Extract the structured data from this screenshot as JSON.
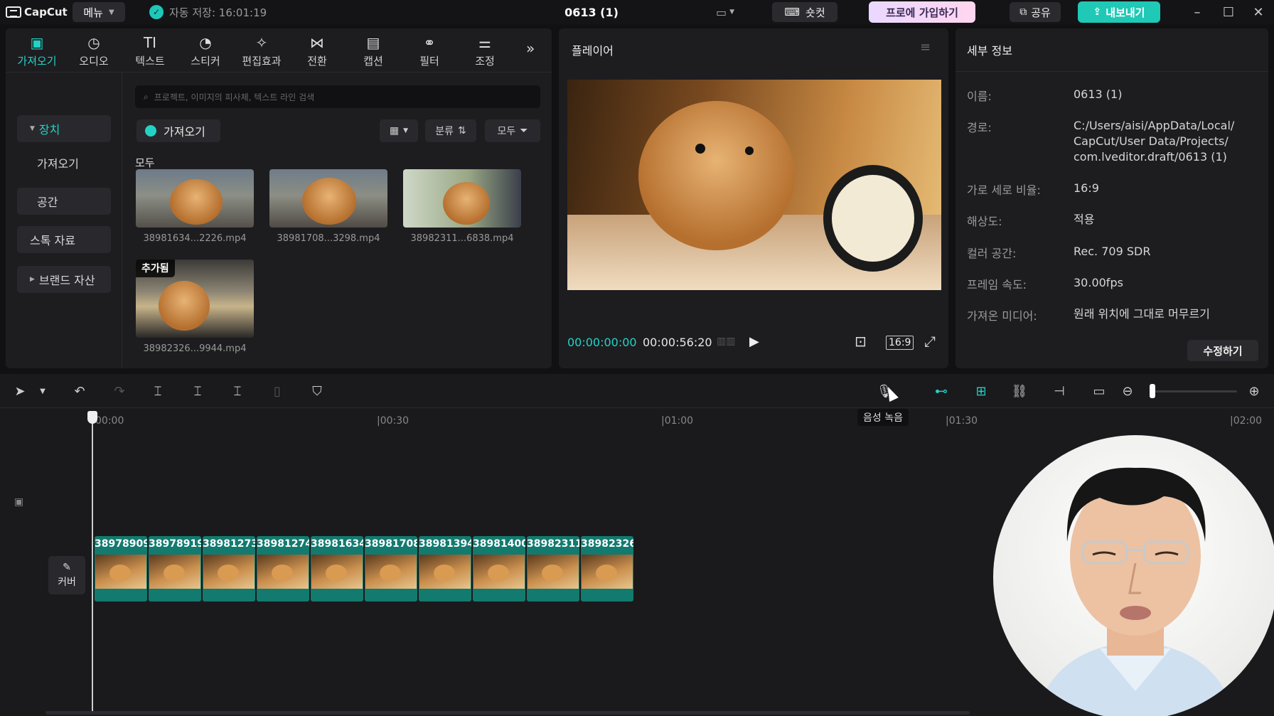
{
  "titlebar": {
    "app_name": "CapCut",
    "menu_label": "메뉴",
    "autosave": "자동 저장: 16:01:19",
    "project_title": "0613 (1)",
    "shortcut_label": "숏컷",
    "pro_label": "프로에 가입하기",
    "share_label": "공유",
    "export_label": "내보내기"
  },
  "media": {
    "tools": [
      {
        "label": "가져오기",
        "icon": "▣"
      },
      {
        "label": "오디오",
        "icon": "◷"
      },
      {
        "label": "텍스트",
        "icon": "TI"
      },
      {
        "label": "스티커",
        "icon": "◔"
      },
      {
        "label": "편집효과",
        "icon": "✧"
      },
      {
        "label": "전환",
        "icon": "⋈"
      },
      {
        "label": "캡션",
        "icon": "▤"
      },
      {
        "label": "필터",
        "icon": "⚭"
      },
      {
        "label": "조정",
        "icon": "⚌"
      }
    ],
    "sidebar": [
      {
        "label": "장치"
      },
      {
        "label": "가져오기"
      },
      {
        "label": "공간"
      },
      {
        "label": "스톡 자료"
      },
      {
        "label": "브랜드 자산"
      }
    ],
    "search_placeholder": "프로젝트, 이미지의 피사체, 텍스트 라인 검색",
    "import_label": "가져오기",
    "sort_label": "분류",
    "filter_label": "모두",
    "all_label": "모두",
    "files": [
      {
        "name": "38981634...2226.mp4"
      },
      {
        "name": "38981708...3298.mp4"
      },
      {
        "name": "38982311...6838.mp4"
      },
      {
        "name": "38982326...9944.mp4",
        "badge": "추가됨"
      }
    ]
  },
  "player": {
    "title": "플레이어",
    "time_current": "00:00:00:00",
    "time_total": "00:00:56:20",
    "ratio": "16:9"
  },
  "details": {
    "title": "세부 정보",
    "rows": [
      {
        "label": "이름:",
        "value": "0613 (1)"
      },
      {
        "label": "경로:",
        "value": "C:/Users/aisi/AppData/Local/ CapCut/User Data/Projects/ com.lveditor.draft/0613 (1)"
      },
      {
        "label": "가로 세로 비율:",
        "value": "16:9"
      },
      {
        "label": "해상도:",
        "value": "적용"
      },
      {
        "label": "컬러 공간:",
        "value": "Rec. 709 SDR"
      },
      {
        "label": "프레임 속도:",
        "value": "30.00fps"
      },
      {
        "label": "가져온 미디어:",
        "value": "원래 위치에 그대로 머무르기"
      }
    ],
    "edit_label": "수정하기"
  },
  "timeline": {
    "tooltip": "음성 녹음",
    "ruler": [
      "00:00",
      "|00:30",
      "|01:00",
      "|01:30",
      "|02:00"
    ],
    "cover_label": "커버",
    "clips": [
      "38978909",
      "38978919",
      "38981273",
      "38981274",
      "38981634",
      "38981708",
      "38981394",
      "38981400",
      "38982311",
      "38982326"
    ]
  },
  "colors": {
    "accent": "#22d3c5",
    "clip": "#137a6f",
    "panel": "#1d1d20"
  }
}
